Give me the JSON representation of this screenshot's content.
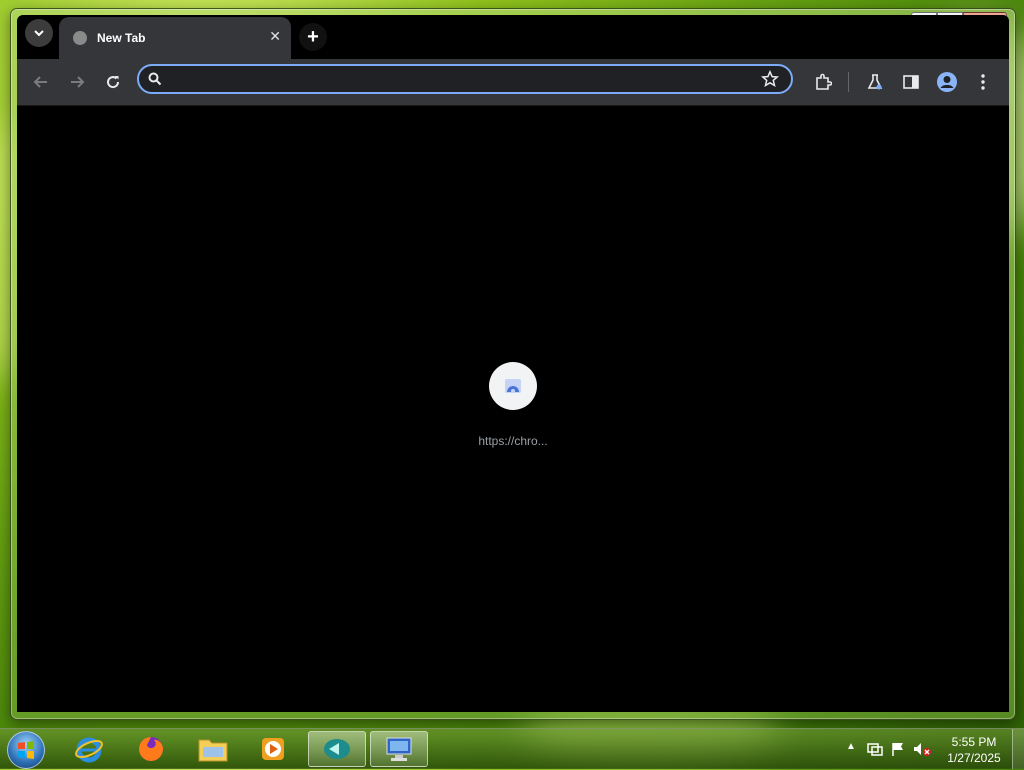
{
  "browser": {
    "tab": {
      "title": "New Tab",
      "close_glyph": "✕"
    },
    "new_tab_glyph": "+",
    "omnibox": {
      "value": "",
      "placeholder": ""
    },
    "icons": [
      "tab-search-icon",
      "back-icon",
      "forward-icon",
      "reload-icon",
      "search-icon",
      "bookmark-star-icon",
      "extensions-icon",
      "labs-icon",
      "side-panel-icon",
      "profile-icon",
      "menu-icon"
    ],
    "accent_color": "#7cacf8"
  },
  "content": {
    "loading_url": "https://chro..."
  },
  "window": {
    "minimize": "–",
    "maximize": "□",
    "close": "✕"
  },
  "taskbar": {
    "apps": [
      "internet-explorer",
      "firefox",
      "file-explorer",
      "media-player",
      "app-teal",
      "remote-desktop"
    ],
    "clock": {
      "time": "5:55 PM",
      "date": "1/27/2025"
    }
  }
}
